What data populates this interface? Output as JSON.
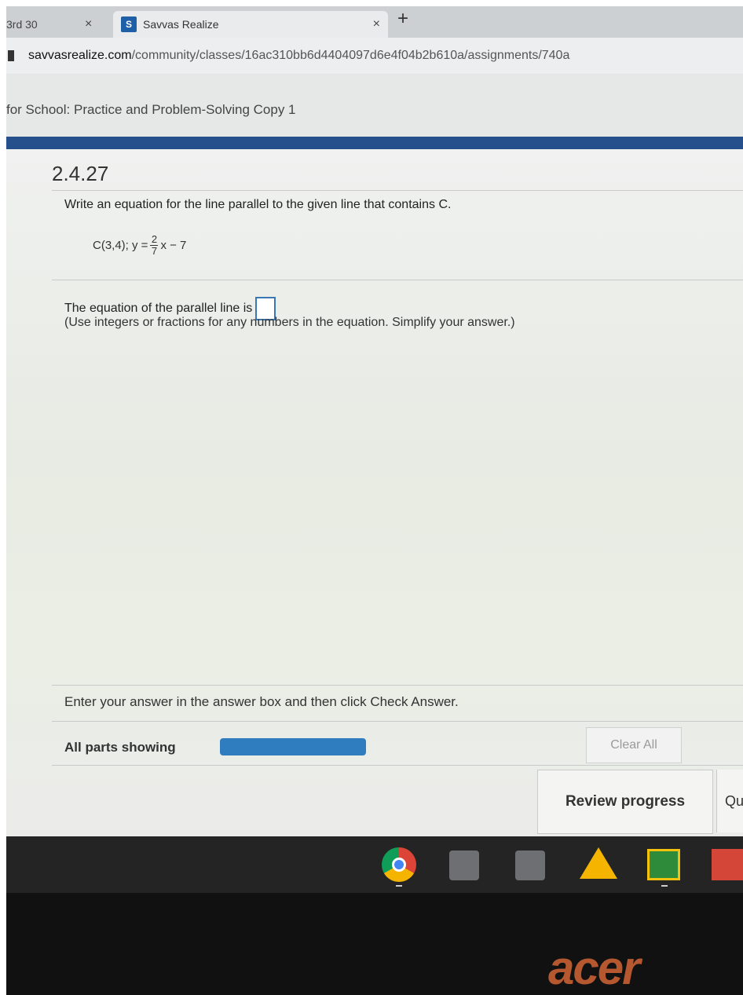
{
  "browser": {
    "tabs": [
      {
        "label": "3rd 30",
        "close": "×"
      },
      {
        "label": "Savvas Realize",
        "favicon": "S",
        "close": "×"
      }
    ],
    "new_tab": "+",
    "url_domain": "savvasrealize.com",
    "url_path": "/community/classes/16ac310bb6d4404097d6e4f04b2b610a/assignments/740a"
  },
  "app": {
    "title": "for School: Practice and Problem-Solving Copy 1",
    "accent": "#26508c"
  },
  "question": {
    "number": "2.4.27",
    "prompt": "Write an equation for the line parallel to the given line that contains C.",
    "point": "C(3,4);",
    "equation_lhs": "y =",
    "numerator": "2",
    "denominator": "7",
    "equation_rest": "x − 7",
    "answer_label": "The equation of the parallel line is",
    "answer_value": "",
    "hint": "(Use integers or fractions for any numbers in the equation. Simplify your answer.)"
  },
  "footer": {
    "instruction": "Enter your answer in the answer box and then click Check Answer.",
    "parts_label": "All parts showing",
    "progress_percent": 100,
    "clear_all": "Clear All",
    "review_progress": "Review progress",
    "next_partial": "Qu"
  },
  "taskbar": {
    "icons": [
      "chrome-icon",
      "app-icon",
      "app-icon",
      "google-drive-icon",
      "google-classroom-icon",
      "gmail-icon"
    ]
  },
  "device": {
    "brand": "acer"
  }
}
